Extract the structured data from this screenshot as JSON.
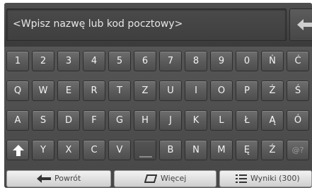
{
  "search": {
    "placeholder": "<Wpisz nazwę lub kod pocztowy>"
  },
  "keyboard": {
    "row1": [
      "1",
      "2",
      "3",
      "4",
      "5",
      "6",
      "7",
      "8",
      "9",
      "0",
      "Ń",
      "Ć"
    ],
    "row2": [
      "Q",
      "W",
      "E",
      "R",
      "T",
      "Z",
      "U",
      "I",
      "O",
      "P",
      "Ż",
      "Ś"
    ],
    "row3": [
      "A",
      "S",
      "D",
      "F",
      "G",
      "H",
      "J",
      "K",
      "L",
      "Ł",
      "Ą",
      "Ó"
    ],
    "row4": [
      "Y",
      "X",
      "C",
      "V",
      "B",
      "N",
      "M",
      "Ę",
      "Ź",
      "@?"
    ]
  },
  "bottom": {
    "back_label": "Powrót",
    "more_label": "Więcej",
    "results_label": "Wyniki (300)"
  },
  "colors": {
    "background": "#4d4d4d",
    "key_text": "#f2f2f2",
    "button_bg": "#e6e6e6"
  },
  "icons": {
    "backspace": "backspace-arrow-icon",
    "shift": "shift-arrow-up-icon",
    "back": "arrow-left-icon",
    "more": "parallelogram-icon",
    "results": "list-icon"
  }
}
